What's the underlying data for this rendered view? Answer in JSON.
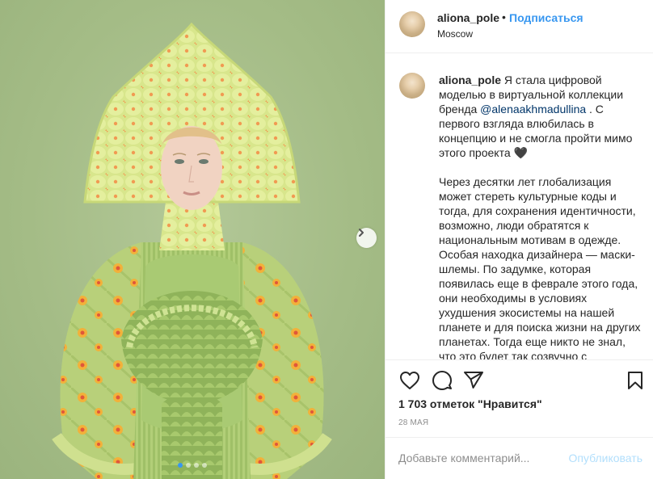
{
  "post": {
    "username": "aliona_pole",
    "separator": "•",
    "follow_label": "Подписаться",
    "location": "Moscow",
    "caption": {
      "username": "aliona_pole",
      "text_1": " Я стала цифровой моделью в виртуальной коллекции бренда ",
      "mention": "@alenaakhmadullina",
      "text_2": " . С первого взгляда влюбилась в концепцию и не смогла пройти мимо этого проекта 🖤\n\nЧерез десятки лет глобализация может стереть культурные коды и тогда, для сохранения идентичности, возможно, люди обратятся к национальным мотивам в одежде. Особая находка дизайнера — маски-шлемы. По задумке, которая появилась еще в феврале этого года, они необходимы в условиях ухудшения экосистемы на нашей планете и для поиска жизни на других планетах. Тогда еще никто не знал, что это будет так созвучно с"
    },
    "likes": "1 703 отметок \"Нравится\"",
    "date": "28 МАЯ",
    "comment_placeholder": "Добавьте комментарий...",
    "publish_label": "Опубликовать",
    "carousel": {
      "slides": 4,
      "active": 0
    }
  },
  "icons": {
    "like": "heart-icon",
    "comment": "comment-icon",
    "share": "share-icon",
    "save": "bookmark-icon",
    "next": "chevron-right-icon"
  },
  "colors": {
    "accent": "#3897f0",
    "mention": "#003569",
    "muted": "#8e8e8e",
    "publish_disabled": "#b2dffc",
    "media_bg": "#a9c18b"
  }
}
